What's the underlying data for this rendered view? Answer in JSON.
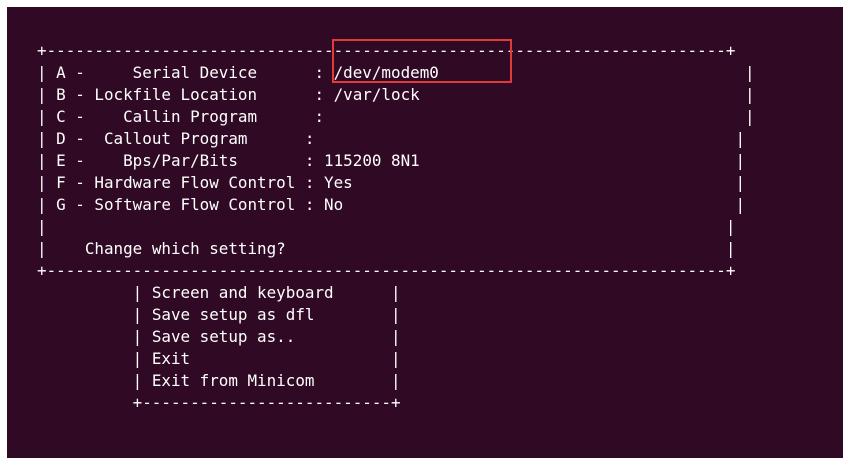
{
  "terminal": {
    "config_box": {
      "border_top": "+-----------------------------------------------------------------------+",
      "border_bottom": "+-----------------------------------------------------------------------+",
      "edge": "|",
      "blank_line": "|                                                                       |",
      "rows": [
        {
          "key_prefix": "| A -     ",
          "label": "Serial Device",
          "label_pad": "      ",
          "sep": ": ",
          "value": "/dev/modem0",
          "right_pad": "                                ",
          "right_edge": "|"
        },
        {
          "key_prefix": "| B - ",
          "label": "Lockfile Location",
          "label_pad": "      ",
          "sep": ": ",
          "value": "/var/lock",
          "right_pad": "                                  ",
          "right_edge": "|"
        },
        {
          "key_prefix": "| C -    ",
          "label": "Callin Program",
          "label_pad": "      ",
          "sep": ":",
          "value": "",
          "right_pad": "                                            ",
          "right_edge": "|"
        },
        {
          "key_prefix": "| D -  ",
          "label": "Callout Program",
          "label_pad": "      ",
          "sep": ":",
          "value": "",
          "right_pad": "                                            ",
          "right_edge": "|"
        },
        {
          "key_prefix": "| E -    ",
          "label": "Bps/Par/Bits",
          "label_pad": "       ",
          "sep": ": ",
          "value": "115200 8N1",
          "right_pad": "                                 ",
          "right_edge": "|"
        },
        {
          "key_prefix": "| F - ",
          "label": "Hardware Flow Control",
          "label_pad": " ",
          "sep": ": ",
          "value": "Yes",
          "right_pad": "                                        ",
          "right_edge": "|"
        },
        {
          "key_prefix": "| G - ",
          "label": "Software Flow Control",
          "label_pad": " ",
          "sep": ": ",
          "value": "No",
          "right_pad": "                                         ",
          "right_edge": "|"
        }
      ],
      "prompt_prefix": "|    ",
      "prompt": "Change which setting?",
      "prompt_suffix": "                                              |"
    },
    "menu_box": {
      "indent": "          ",
      "edge": "| ",
      "items": [
        {
          "label": "Screen and keyboard",
          "pad": "      |"
        },
        {
          "label": "Save setup as dfl",
          "pad": "        |"
        },
        {
          "label": "Save setup as..",
          "pad": "          |"
        },
        {
          "label": "Exit",
          "pad": "                     |"
        },
        {
          "label": "Exit from Minicom",
          "pad": "        |"
        }
      ],
      "border_bottom": "+--------------------------+"
    },
    "colors": {
      "background": "#300a24",
      "text": "#ffffff",
      "highlight": "#e03a3a"
    }
  }
}
